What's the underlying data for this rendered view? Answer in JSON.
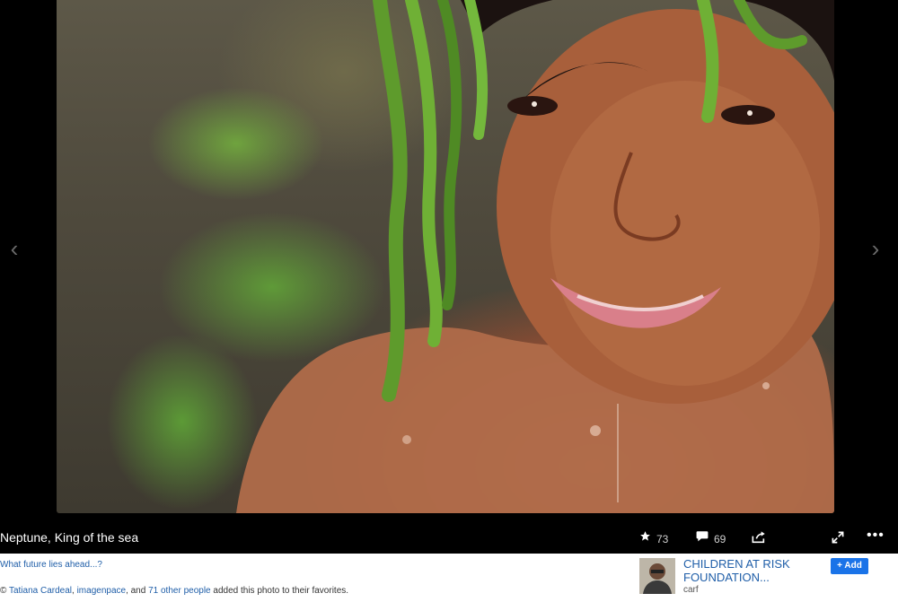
{
  "photo": {
    "title": "Neptune, King of the sea",
    "faves_count": "73",
    "comments_count": "69",
    "description_link": "What future lies ahead...?",
    "faves_prefix": "© ",
    "faves_user1": "Tatiana Cardeal",
    "faves_sep1": ", ",
    "faves_user2": "imagenpace",
    "faves_sep2": ", and ",
    "faves_others": "71 other people",
    "faves_suffix": " added this photo to their favorites."
  },
  "nav": {
    "prev_glyph": "‹",
    "next_glyph": "›"
  },
  "group": {
    "name": "CHILDREN AT RISK FOUNDATION...",
    "subtitle": "carf",
    "add_label": "+ Add"
  },
  "icons": {
    "star": "star-icon",
    "comment": "comment-icon",
    "share": "share-icon",
    "expand": "expand-icon",
    "more": "more-icon"
  },
  "colors": {
    "link": "#1f5ea8",
    "add_button": "#1a73e8",
    "stage": "#000000"
  }
}
